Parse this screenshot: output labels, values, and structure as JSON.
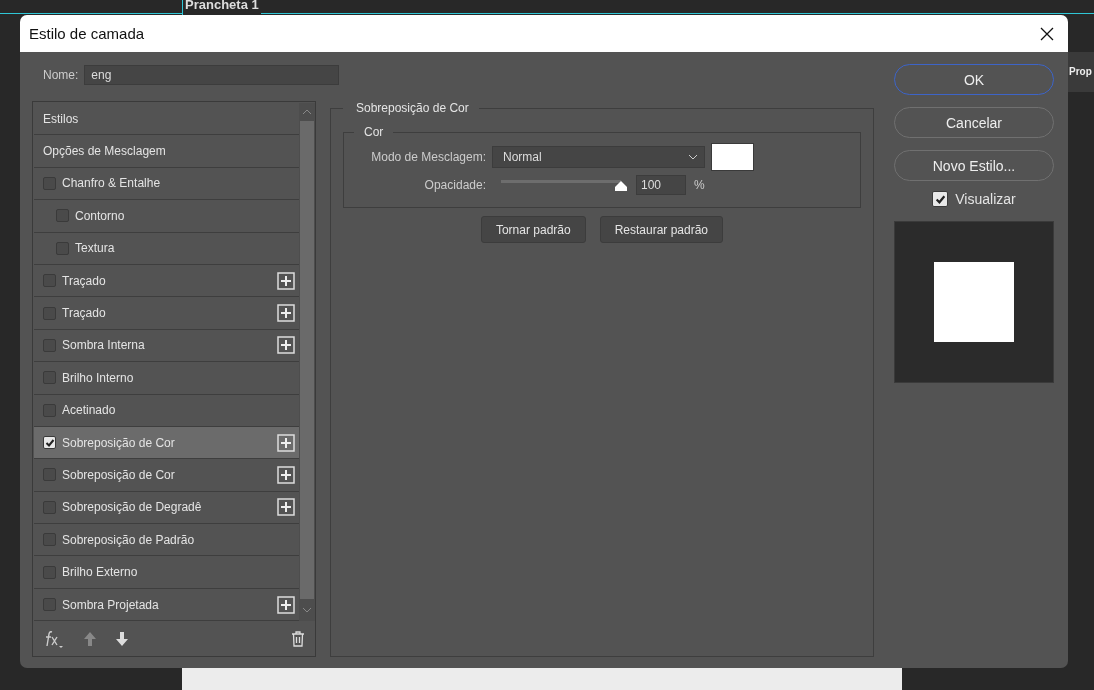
{
  "background": {
    "document_tab": "Prancheta 1",
    "panel_tab": "Prop"
  },
  "dialog": {
    "title": "Estilo de camada",
    "name_label": "Nome:",
    "name_value": "eng",
    "styles": [
      {
        "kind": "header",
        "label": "Estilos",
        "selected": false
      },
      {
        "kind": "header",
        "label": "Opções de Mesclagem",
        "selected": false
      },
      {
        "kind": "effect",
        "label": "Chanfro & Entalhe",
        "checked": false,
        "selected": false,
        "addable": false,
        "children": [
          {
            "kind": "effect",
            "label": "Contorno",
            "checked": false,
            "selected": false,
            "addable": false
          },
          {
            "kind": "effect",
            "label": "Textura",
            "checked": false,
            "selected": false,
            "addable": false
          }
        ]
      },
      {
        "kind": "effect",
        "label": "Traçado",
        "checked": false,
        "selected": false,
        "addable": true
      },
      {
        "kind": "effect",
        "label": "Traçado",
        "checked": false,
        "selected": false,
        "addable": true
      },
      {
        "kind": "effect",
        "label": "Sombra Interna",
        "checked": false,
        "selected": false,
        "addable": true
      },
      {
        "kind": "effect",
        "label": "Brilho Interno",
        "checked": false,
        "selected": false,
        "addable": false
      },
      {
        "kind": "effect",
        "label": "Acetinado",
        "checked": false,
        "selected": false,
        "addable": false
      },
      {
        "kind": "effect",
        "label": "Sobreposição de Cor",
        "checked": true,
        "selected": true,
        "addable": true
      },
      {
        "kind": "effect",
        "label": "Sobreposição de Cor",
        "checked": false,
        "selected": false,
        "addable": true
      },
      {
        "kind": "effect",
        "label": "Sobreposição de Degradê",
        "checked": false,
        "selected": false,
        "addable": true
      },
      {
        "kind": "effect",
        "label": "Sobreposição de Padrão",
        "checked": false,
        "selected": false,
        "addable": false
      },
      {
        "kind": "effect",
        "label": "Brilho Externo",
        "checked": false,
        "selected": false,
        "addable": false
      },
      {
        "kind": "effect",
        "label": "Sombra Projetada",
        "checked": false,
        "selected": false,
        "addable": true
      }
    ],
    "panel": {
      "title": "Sobreposição de Cor",
      "group_title": "Cor",
      "blend_label": "Modo de Mesclagem:",
      "blend_value": "Normal",
      "opacity_label": "Opacidade:",
      "opacity": {
        "level": 1.0
      },
      "opacity_value": "100",
      "opacity_unit": "%",
      "buttons": [
        "Tornar padrão",
        "Restaurar padrão"
      ]
    },
    "actions": [
      {
        "label": "OK",
        "selected": true
      },
      {
        "label": "Cancelar",
        "selected": false
      },
      {
        "label": "Novo Estilo...",
        "selected": false
      }
    ],
    "preview": {
      "label": "Visualizar",
      "checked": true
    }
  }
}
